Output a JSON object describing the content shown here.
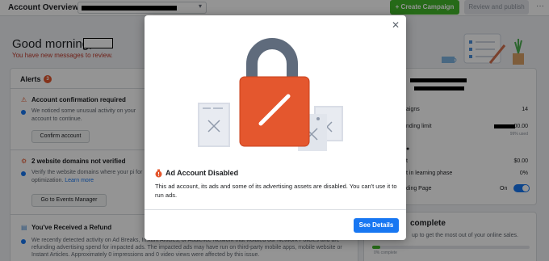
{
  "topbar": {
    "title": "Account Overview",
    "create_label": "+ Create Campaign",
    "review_label": "Review and publish",
    "more_label": "···"
  },
  "greeting": {
    "text": "Good morning,",
    "messages": "You have new messages to review."
  },
  "alerts": {
    "title": "Alerts",
    "count": "3",
    "items": [
      {
        "title": "Account confirmation required",
        "text": "We noticed some unusual activity on your account to continue.",
        "button": "Confirm account"
      },
      {
        "title": "2 website domains not verified",
        "text": "Verify the website domains where your pi for optimization.",
        "learn": "Learn more",
        "button": "Go to Events Manager"
      },
      {
        "title": "You've Received a Refund",
        "text": "We recently detected activity on Ad Breaks, Instant Articles, or Audience Network that violated our Network Policies and are refunding advertising spend for impacted ads. The impacted ads may have run on third-party mobile apps, mobile website or Instant Articles. Approximately 0 impressions and 0 video views were affected by this issue."
      }
    ]
  },
  "summary": {
    "rows": [
      {
        "label": "aigns",
        "value": "14"
      },
      {
        "label": "nding limit",
        "value": "00.00",
        "sub": "99% used"
      },
      {
        "label": "t",
        "value": "$0.00"
      },
      {
        "label": "t in learning phase",
        "value": "0%"
      },
      {
        "label": "ding Page",
        "value": "On"
      }
    ]
  },
  "complete": {
    "title": "complete",
    "text": "up to get the most out of your online sales.",
    "progress_label": "0% complete",
    "progress": 0.05
  },
  "modal": {
    "title": "Ad Account Disabled",
    "body": "This ad account, its ads and some of its advertising assets are disabled. You can't use it to run ads.",
    "button": "See Details"
  },
  "colors": {
    "primary": "#1877f2",
    "green": "#42b72a",
    "lock": "#e4572e",
    "warning": "#c0392b"
  }
}
